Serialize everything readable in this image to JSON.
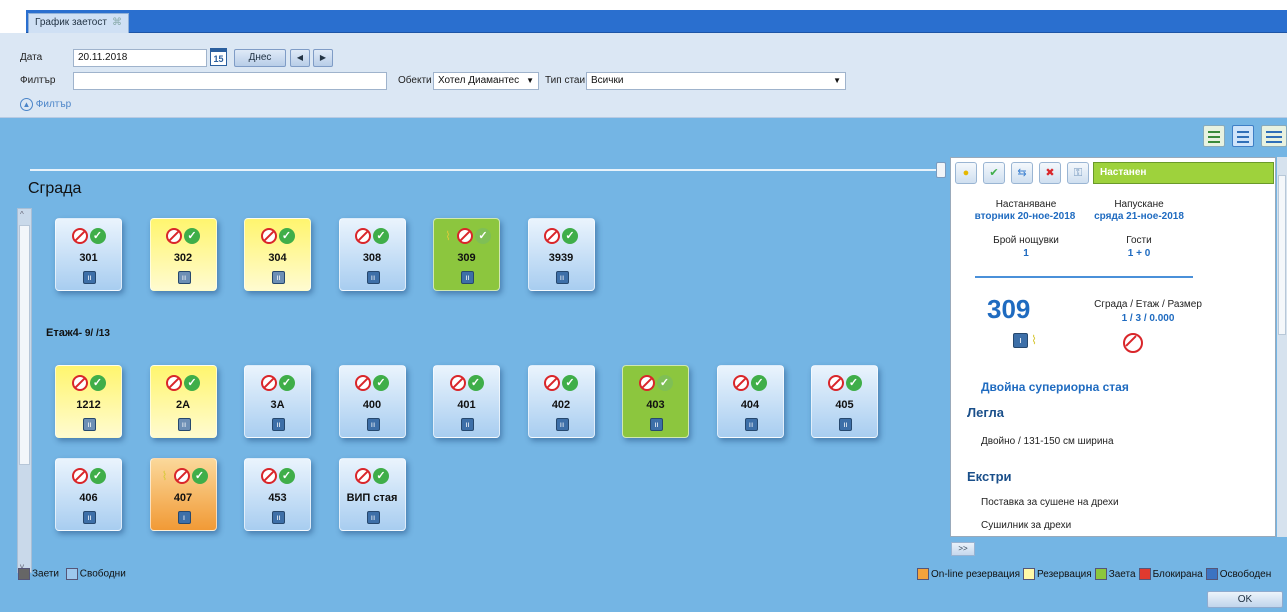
{
  "tab": {
    "title": "График заетост",
    "close": "⌘"
  },
  "toolbar": {
    "date_label": "Дата",
    "date_value": "20.11.2018",
    "calendar_day": "15",
    "today_button": "Днес",
    "prev": "◀",
    "next": "▶",
    "filter_label": "Филтър",
    "filter_value": "",
    "objects_label": "Обекти",
    "objects_value": "Хотел Диамантес",
    "room_type_label": "Тип стаи",
    "room_type_value": "Всички",
    "filter_toggle": "Филтър"
  },
  "building_title": "Сграда",
  "floors": [
    {
      "label": "",
      "rooms": [
        {
          "number": "301",
          "color": "blue",
          "brush": false,
          "beds": "ıı"
        },
        {
          "number": "302",
          "color": "yellow",
          "brush": false,
          "beds": "ıı"
        },
        {
          "number": "304",
          "color": "yellow",
          "brush": false,
          "beds": "ıı"
        },
        {
          "number": "308",
          "color": "blue",
          "brush": false,
          "beds": "ıı"
        },
        {
          "number": "309",
          "color": "green",
          "brush": true,
          "beds": "ıı"
        },
        {
          "number": "3939",
          "color": "blue",
          "brush": false,
          "beds": "ıı"
        }
      ]
    },
    {
      "label": "Етаж4",
      "counts": "- 9/ /13",
      "rooms": [
        {
          "number": "1212",
          "color": "yellow",
          "brush": false,
          "beds": "ıı"
        },
        {
          "number": "2A",
          "color": "yellow",
          "brush": false,
          "beds": "ıı"
        },
        {
          "number": "3A",
          "color": "blue",
          "brush": false,
          "beds": "ıı"
        },
        {
          "number": "400",
          "color": "blue",
          "brush": false,
          "beds": "ıı"
        },
        {
          "number": "401",
          "color": "blue",
          "brush": false,
          "beds": "ıı"
        },
        {
          "number": "402",
          "color": "blue",
          "brush": false,
          "beds": "ıı"
        },
        {
          "number": "403",
          "color": "green",
          "brush": false,
          "beds": "ıı"
        },
        {
          "number": "404",
          "color": "blue",
          "brush": false,
          "beds": "ıı"
        },
        {
          "number": "405",
          "color": "blue",
          "brush": false,
          "beds": "ıı"
        },
        {
          "number": "406",
          "color": "blue",
          "brush": false,
          "beds": "ıı"
        },
        {
          "number": "407",
          "color": "orange",
          "brush": true,
          "beds": "ı"
        },
        {
          "number": "453",
          "color": "blue",
          "brush": false,
          "beds": "ıı"
        },
        {
          "number": "ВИП стая",
          "color": "blue",
          "brush": false,
          "beds": "ıı"
        }
      ]
    }
  ],
  "legend_left": {
    "occupied": "Заети",
    "free": "Свободни"
  },
  "panel": {
    "status": "Настанен",
    "checkin_label": "Настаняване",
    "checkin_value": "вторник 20-ное-2018",
    "checkout_label": "Напускане",
    "checkout_value": "сряда 21-ное-2018",
    "nights_label": "Брой нощувки",
    "nights_value": "1",
    "guests_label": "Гости",
    "guests_value": "1 + 0",
    "room_number": "309",
    "bfs_label": "Сграда / Етаж / Размер",
    "bfs_value": "1 / 3 / 0.000",
    "room_type": "Двойна супериорна стая",
    "beds_heading": "Легла",
    "beds_text": "Двойно / 131-150 см ширина",
    "extras_heading": "Екстри",
    "extras": [
      "Поставка за сушене на дрехи",
      "Сушилник за дрехи"
    ]
  },
  "expand_button": ">>",
  "legend_right": [
    {
      "label": "On-line резервация",
      "color": "#f3a33c"
    },
    {
      "label": "Резервация",
      "color": "#fff9a8"
    },
    {
      "label": "Заета",
      "color": "#8cc63e"
    },
    {
      "label": "Блокирана",
      "color": "#e03a2f"
    },
    {
      "label": "Освободен",
      "color": "#3b73c2"
    }
  ],
  "ok_button": "OK"
}
